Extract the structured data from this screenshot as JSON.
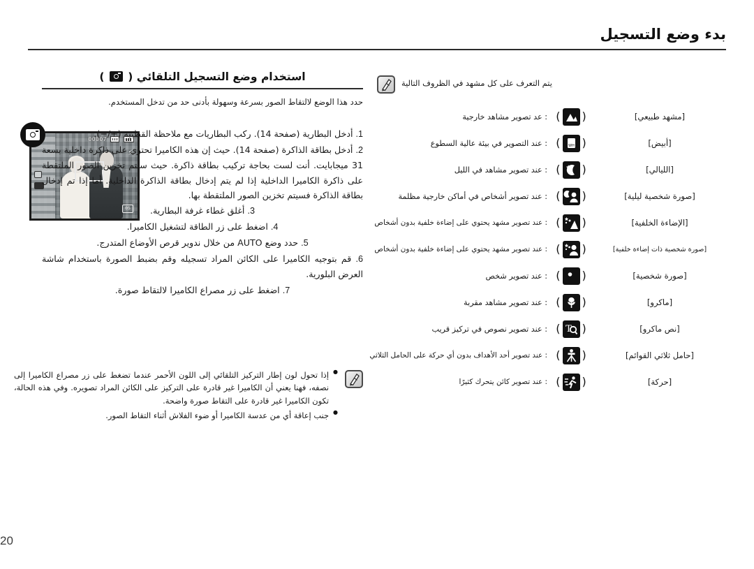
{
  "header": {
    "title": "بدء وضع التسجيل"
  },
  "left": {
    "subheading_before": "استخدام وضع التسجيل التلقائي ( ",
    "subheading_icon": "camera-auto-mode-icon",
    "subheading_after": " )",
    "lead_paragraph": "حدد هذا الوضع لالتقاط الصور بسرعة وسهولة بأدنى حد من تدخل المستخدم.",
    "steps": [
      {
        "num": "1.",
        "text": "أدخل البطارية (صفحة 14). ركب البطاريات مع ملاحظة القطبية (+/−)."
      },
      {
        "num": "2.",
        "text": "أدخل بطاقة الذاكرة (صفحة 14). حيث إن هذه الكاميرا تحتوي على ذاكرة داخلية بسعة 31 ميجابايت. أنت لست بحاجة تركيب بطاقة ذاكرة. حيث سيتم تخزين الصور الملتقطة على ذاكرة الكاميرا الداخلية إذا لم يتم إدخال بطاقة الذاكرة الداخلية. أما إذا تم إدخال بطاقة الذاكرة فسيتم تخزين الصور الملتقطة بها."
      },
      {
        "num": "3.",
        "text": "أغلق غطاء غرفة البطارية."
      },
      {
        "num": "4.",
        "text": "اضغط على زر الطاقة لتشغيل الكاميرا."
      },
      {
        "num": "5.",
        "text": "حدد وضع AUTO من خلال ندوير قرص الأوضاع المتدرج."
      },
      {
        "num": "6.",
        "text": "قم بتوجيه الكاميرا على الكائن المراد تسجيله وقم بضبط الصورة باستخدام شاشة العرض البلورية."
      },
      {
        "num": "7.",
        "text": "اضغط على زر مصراع الكاميرا لالتقاط صورة."
      }
    ]
  },
  "note": {
    "icon": "hand-note-icon",
    "bullets": [
      "إذا تحول لون إطار التركيز التلقائي إلى اللون الأحمر عندما تضغط على زر مصراع الكاميرا إلى نصفه، فهنا يعني أن الكاميرا غير قادرة على التركيز على الكائن المراد تصويره. وفي هذه الحالة، تكون الكاميرا غير قادرة على التقاط صورة واضحة.",
      "جنب إعاقة أي من عدسة الكاميرا أو ضوء الفلاش أثناء التقاط الصور."
    ]
  },
  "lcd": {
    "mode_callout_icon": "auto-mode-callout-icon",
    "frame_counter": "00007",
    "card_icon": "memory-card-icon",
    "battery_icon": "battery-icon",
    "flash_icon": "flash-auto-icon",
    "timer_label": "05",
    "af_frame": "af-focus-frame"
  },
  "scene": {
    "note_icon": "hand-note-icon",
    "intro": "يتم التعرف على كل مشهد في الظروف التالية",
    "rows": [
      {
        "name": "[مشهد طبيعي]",
        "icon": "landscape-icon",
        "desc": ": عد تصوير مشاهد خارجية"
      },
      {
        "name": "[أبيض]",
        "icon": "white-balance-icon",
        "desc": ": عند التصوير في بيئة عالية السطوع"
      },
      {
        "name": "[الليالي]",
        "icon": "night-icon",
        "desc": ": عند تصوير مشاهد في الليل"
      },
      {
        "name": "[صورة شخصية ليلية]",
        "icon": "night-portrait-icon",
        "desc": ": عند تصوير أشخاص في أماكن خارجية مظلمة"
      },
      {
        "name": "[الإضاءة الخلفية]",
        "icon": "backlight-icon",
        "desc": ": عند تصوير مشهد يحتوي على إضاءة خلفية بدون أشخاص"
      },
      {
        "name": "[صورة شخصية ذات إضاءة خلفية]",
        "icon": "backlight-portrait-icon",
        "desc": ": عند تصوير مشهد يحتوي على إضاءة خلفية بدون أشخاص"
      },
      {
        "name": "[صورة شخصية]",
        "icon": "portrait-icon",
        "desc": ": عند تصوير شخص"
      },
      {
        "name": "[ماكرو]",
        "icon": "macro-flower-icon",
        "desc": ": عند تصوير مشاهد مقربة"
      },
      {
        "name": "[نص ماكرو]",
        "icon": "macro-text-icon",
        "desc": ": عند تصوير نصوص في تركيز قريب"
      },
      {
        "name": "[حامل ثلاثي القوائم]",
        "icon": "tripod-icon",
        "desc": ": عند تصوير أحد الأهداف بدون أي حركة على الحامل الثلاثي"
      },
      {
        "name": "[حركة]",
        "icon": "action-icon",
        "desc": ": عند تصوير كائن يتحرك كثيرًا"
      }
    ]
  },
  "footer": {
    "page_number": "20"
  },
  "colors": {
    "ink": "#1a1a1a",
    "rule": "#2a2a2a",
    "icon_bg": "#111111"
  }
}
